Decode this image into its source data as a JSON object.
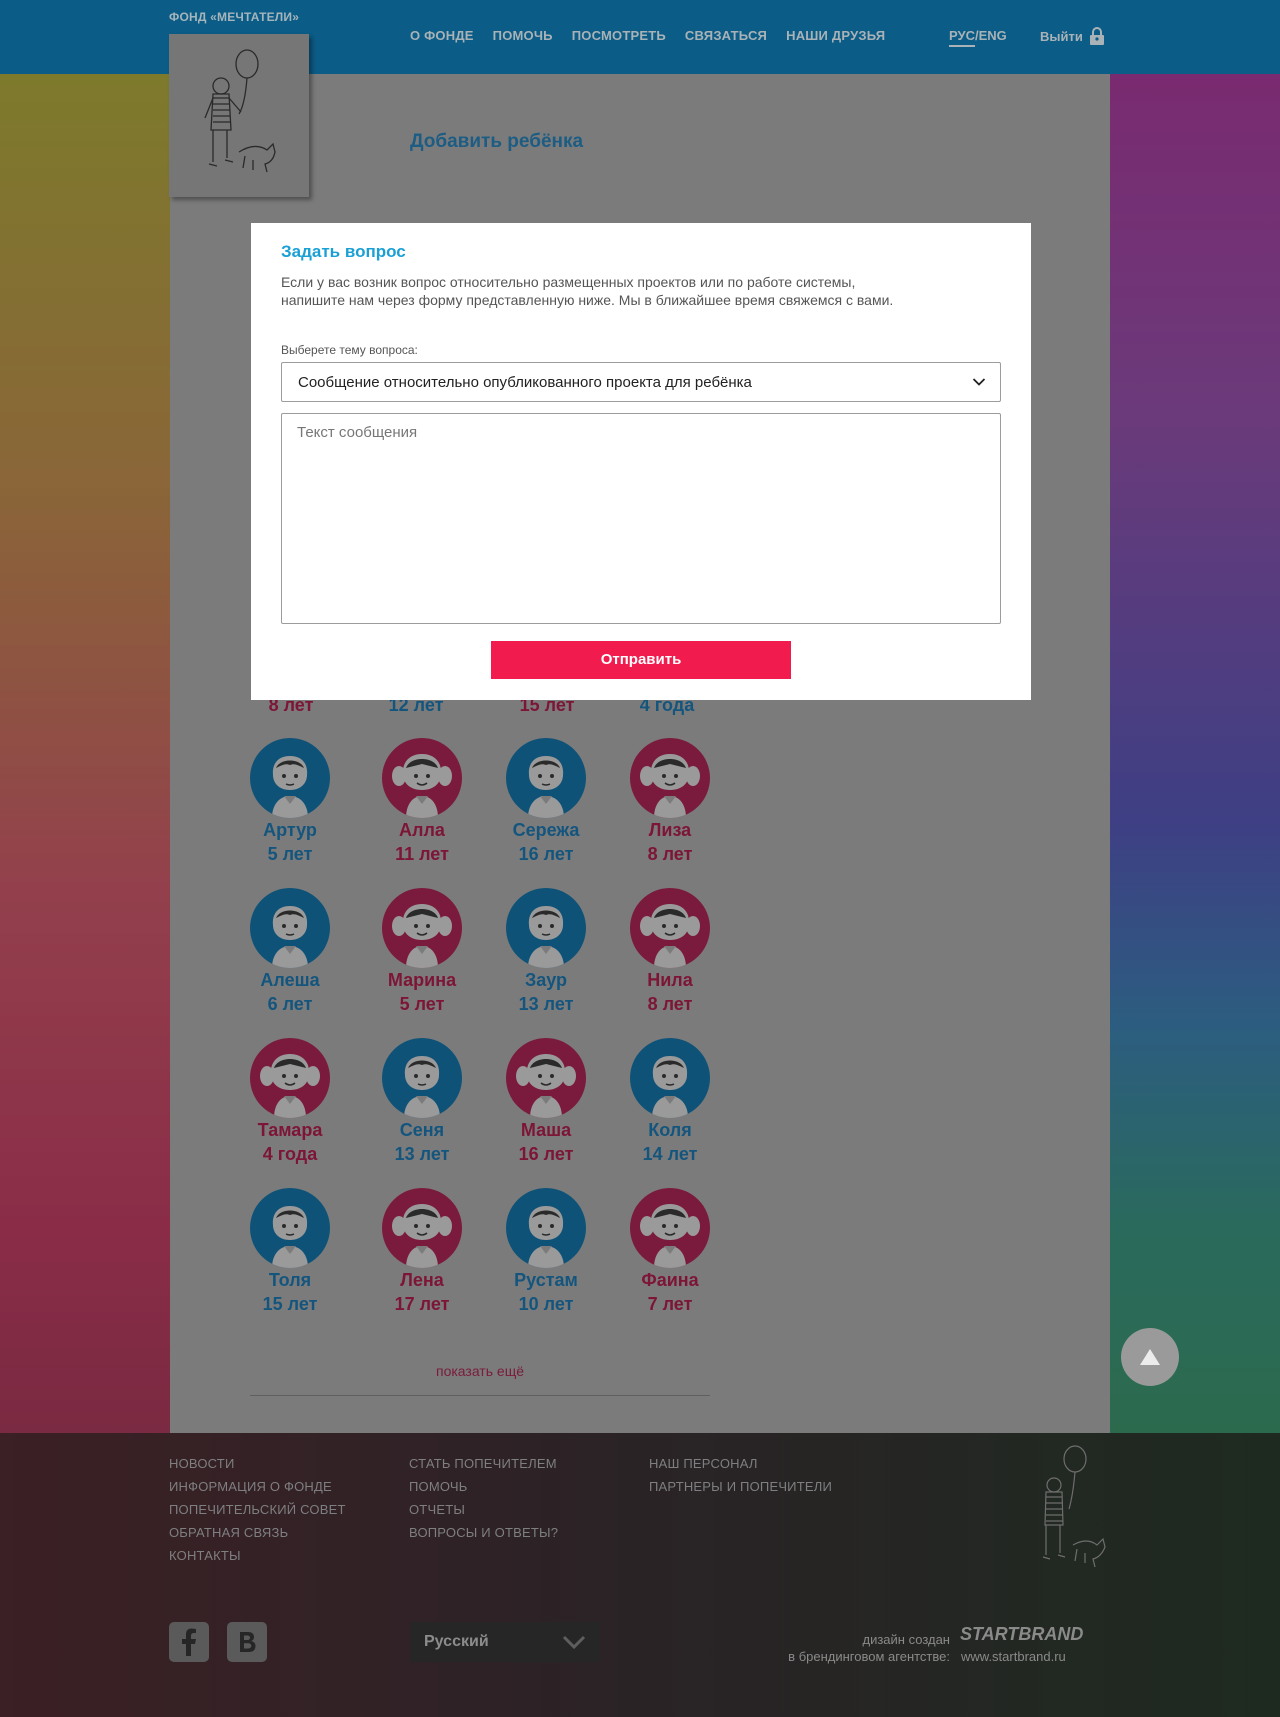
{
  "header": {
    "brand": "ФОНД «МЕЧТАТЕЛИ»",
    "nav": [
      "О ФОНДЕ",
      "ПОМОЧЬ",
      "ПОСМОТРЕТЬ",
      "СВЯЗАТЬСЯ",
      "НАШИ ДРУЗЬЯ"
    ],
    "lang_active": "РУС",
    "lang_sep": "/",
    "lang_other": "ENG",
    "logout": "Выйти"
  },
  "page": {
    "title": "Добавить ребёнка",
    "partial_ages": [
      "8 лет",
      "12 лет",
      "15 лет",
      "4 года"
    ],
    "children": [
      {
        "name": "Артур",
        "age": "5 лет",
        "gender": "boy"
      },
      {
        "name": "Алла",
        "age": "11 лет",
        "gender": "girl"
      },
      {
        "name": "Сережа",
        "age": "16 лет",
        "gender": "boy"
      },
      {
        "name": "Лиза",
        "age": "8 лет",
        "gender": "girl"
      },
      {
        "name": "Алеша",
        "age": "6 лет",
        "gender": "boy"
      },
      {
        "name": "Марина",
        "age": "5 лет",
        "gender": "girl"
      },
      {
        "name": "Заур",
        "age": "13 лет",
        "gender": "boy"
      },
      {
        "name": "Нила",
        "age": "8 лет",
        "gender": "girl"
      },
      {
        "name": "Тамара",
        "age": "4 года",
        "gender": "girl"
      },
      {
        "name": "Сеня",
        "age": "13 лет",
        "gender": "boy"
      },
      {
        "name": "Маша",
        "age": "16 лет",
        "gender": "girl"
      },
      {
        "name": "Коля",
        "age": "14 лет",
        "gender": "boy"
      },
      {
        "name": "Толя",
        "age": "15 лет",
        "gender": "boy"
      },
      {
        "name": "Лена",
        "age": "17 лет",
        "gender": "girl"
      },
      {
        "name": "Рустам",
        "age": "10 лет",
        "gender": "boy"
      },
      {
        "name": "Фаина",
        "age": "7 лет",
        "gender": "girl"
      }
    ],
    "show_more": "показать ещё"
  },
  "modal": {
    "title": "Задать вопрос",
    "description": "Если у вас возник вопрос относительно размещенных проектов или по работе системы, напишите нам через форму представленную ниже. Мы в ближайшее время свяжемся с вами.",
    "topic_label": "Выберете тему вопроса:",
    "topic_selected": "Сообщение относительно опубликованного проекта для ребёнка",
    "message_placeholder": "Текст сообщения",
    "submit": "Отправить"
  },
  "footer": {
    "col1": [
      "НОВОСТИ",
      "ИНФОРМАЦИЯ О ФОНДЕ",
      "ПОПЕЧИТЕЛЬСКИЙ СОВЕТ",
      "ОБРАТНАЯ СВЯЗЬ",
      "КОНТАКТЫ"
    ],
    "col2": [
      "СТАТЬ ПОПЕЧИТЕЛЕМ",
      "ПОМОЧЬ",
      "ОТЧЕТЫ",
      "ВОПРОСЫ И ОТВЕТЫ?"
    ],
    "col3": [
      "НАШ ПЕРСОНАЛ",
      "ПАРТНЕРЫ И ПОПЕЧИТЕЛИ"
    ],
    "language": "Русский",
    "credit_line1": "дизайн создан",
    "credit_line2": "в брендинговом агентстве:",
    "agency": "STARTBRAND",
    "agency_url": "www.startbrand.ru"
  },
  "icons": {
    "lock": "lock-icon",
    "facebook": "facebook-icon",
    "vk": "vk-icon",
    "chevron": "chevron-down-icon",
    "to_top": "arrow-up-icon"
  },
  "colors": {
    "header_bg": "#0b5c86",
    "accent_blue": "#1aa0d4",
    "submit_red": "#f21b4e",
    "boy": "#0f5278",
    "girl": "#7a1a3c"
  }
}
